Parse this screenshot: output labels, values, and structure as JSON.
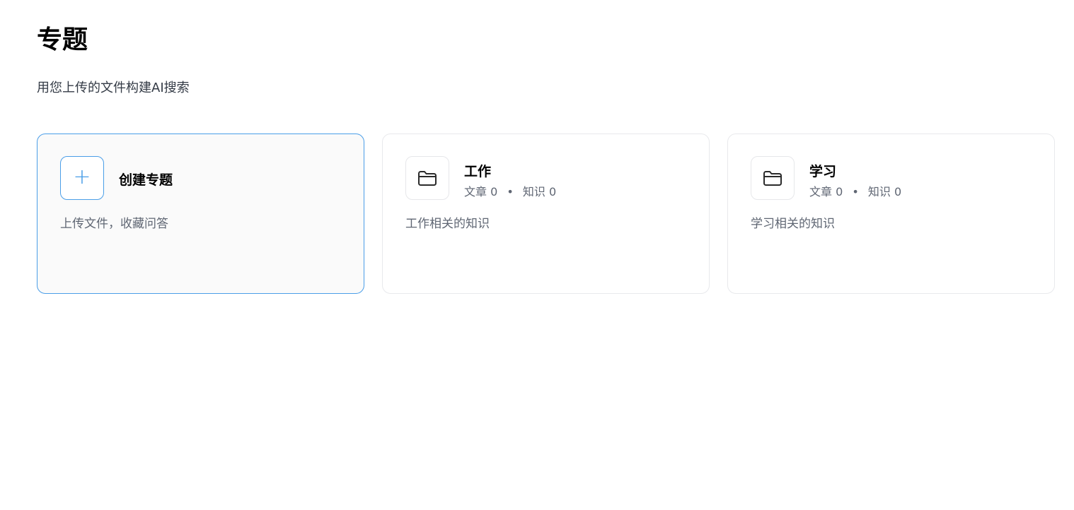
{
  "header": {
    "title": "专题",
    "subtitle": "用您上传的文件构建AI搜索"
  },
  "create_card": {
    "title": "创建专题",
    "description": "上传文件，收藏问答",
    "icon": "plus-icon",
    "accent_color": "#4a9ee8"
  },
  "topics": [
    {
      "title": "工作",
      "articles_label": "文章",
      "articles_count": "0",
      "knowledge_label": "知识",
      "knowledge_count": "0",
      "separator": "•",
      "description": "工作相关的知识",
      "icon": "folder-icon"
    },
    {
      "title": "学习",
      "articles_label": "文章",
      "articles_count": "0",
      "knowledge_label": "知识",
      "knowledge_count": "0",
      "separator": "•",
      "description": "学习相关的知识",
      "icon": "folder-icon"
    }
  ]
}
